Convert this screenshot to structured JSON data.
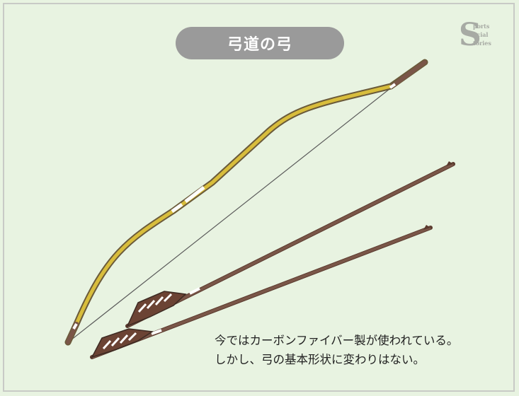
{
  "title": "弓道の弓",
  "logo": {
    "letters": [
      "S",
      "ports",
      "ocial",
      "tories"
    ]
  },
  "caption": {
    "line1": "今ではカーボンファイバー製が使われている。",
    "line2": "しかし、弓の基本形状に変わりはない。"
  },
  "colors": {
    "background": "#e8f3e1",
    "bow_body": "#d8bd3c",
    "wood": "#7a5648",
    "fletching_dark": "#6b4334",
    "title_pill": "#9a9a9a"
  }
}
